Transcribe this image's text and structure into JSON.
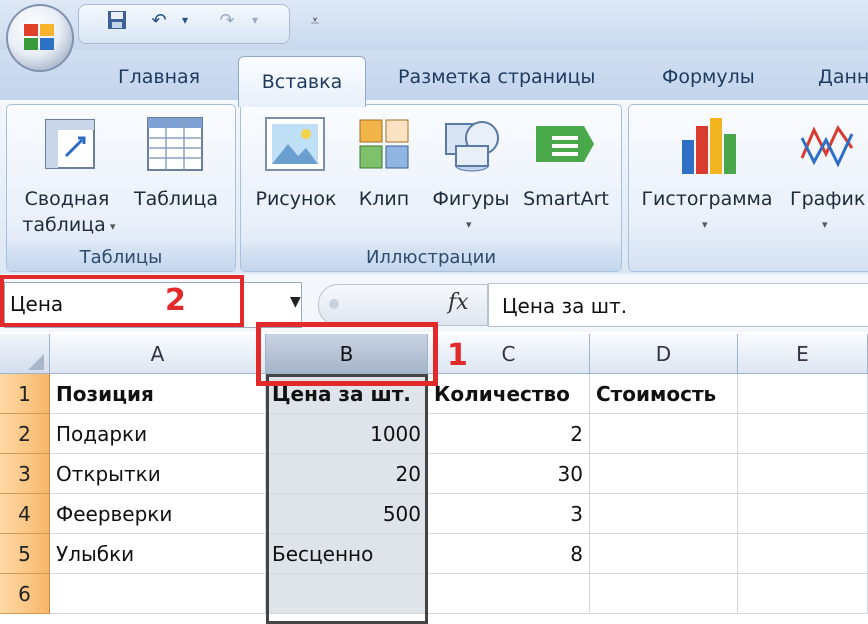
{
  "ribbon": {
    "tabs": [
      {
        "label": "Главная"
      },
      {
        "label": "Вставка"
      },
      {
        "label": "Разметка страницы"
      },
      {
        "label": "Формулы"
      },
      {
        "label": "Данн"
      }
    ],
    "groups": {
      "tables": {
        "label": "Таблицы",
        "pivot_line1": "Сводная",
        "pivot_line2": "таблица",
        "table": "Таблица"
      },
      "illustrations": {
        "label": "Иллюстрации",
        "picture": "Рисунок",
        "clip": "Клип",
        "shapes": "Фигуры",
        "smartart": "SmartArt"
      },
      "charts": {
        "histogram": "Гистограмма",
        "graph": "График"
      }
    }
  },
  "namebox": {
    "value": "Цена"
  },
  "formula_bar": {
    "fx": "fx",
    "value": "Цена за шт."
  },
  "annotations": {
    "num1": "1",
    "num2": "2"
  },
  "sheet": {
    "columns": [
      "A",
      "B",
      "C",
      "D",
      "E"
    ],
    "rows": [
      {
        "n": "1",
        "a": "Позиция",
        "b": "Цена за шт.",
        "c": "Количество",
        "d": "Стоимость"
      },
      {
        "n": "2",
        "a": "Подарки",
        "b": "1000",
        "c": "2",
        "d": ""
      },
      {
        "n": "3",
        "a": "Открытки",
        "b": "20",
        "c": "30",
        "d": ""
      },
      {
        "n": "4",
        "a": "Феерверки",
        "b": "500",
        "c": "3",
        "d": ""
      },
      {
        "n": "5",
        "a": "Улыбки",
        "b": "Бесценно",
        "c": "8",
        "d": ""
      },
      {
        "n": "6",
        "a": "",
        "b": "",
        "c": "",
        "d": ""
      }
    ]
  },
  "colors": {
    "annotation": "#e32a2a",
    "row_header": "#f6b86a",
    "selected_col": "#dfe3ea"
  }
}
